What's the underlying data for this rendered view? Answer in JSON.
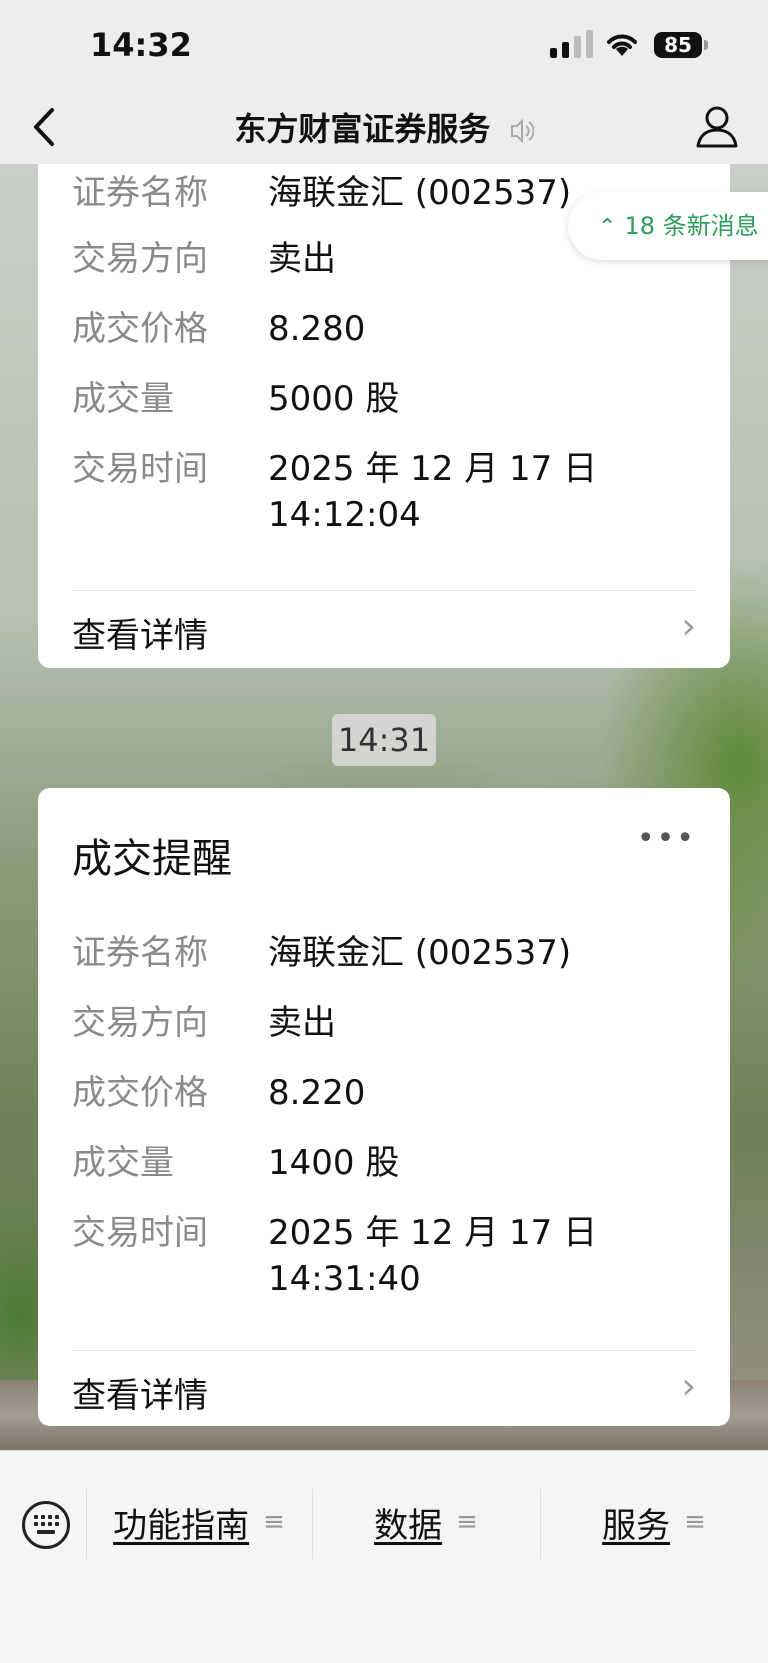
{
  "status": {
    "time": "14:32",
    "battery": "85"
  },
  "nav": {
    "title": "东方财富证券服务"
  },
  "new_messages": {
    "label": "18 条新消息"
  },
  "card1": {
    "rows": [
      {
        "k": "证券名称",
        "v": "海联金汇 (002537)"
      },
      {
        "k": "交易方向",
        "v": "卖出"
      },
      {
        "k": "成交价格",
        "v": "8.280"
      },
      {
        "k": "成交量",
        "v": "5000 股"
      },
      {
        "k": "交易时间",
        "v": "2025 年 12 月 17 日 14:12:04"
      }
    ],
    "detail": "查看详情"
  },
  "timestamp": "14:31",
  "card2": {
    "title": "成交提醒",
    "rows": [
      {
        "k": "证券名称",
        "v": "海联金汇 (002537)"
      },
      {
        "k": "交易方向",
        "v": "卖出"
      },
      {
        "k": "成交价格",
        "v": "8.220"
      },
      {
        "k": "成交量",
        "v": "1400 股"
      },
      {
        "k": "交易时间",
        "v": "2025 年 12 月 17 日 14:31:40"
      }
    ],
    "detail": "查看详情"
  },
  "menu": {
    "items": [
      "功能指南",
      "数据",
      "服务"
    ]
  },
  "icons": {
    "back": "chevron-left-icon",
    "speaker": "speaker-icon",
    "profile": "person-icon",
    "more": "ellipsis-icon",
    "keyboard": "keyboard-icon",
    "menu": "hamburger-icon"
  },
  "colors": {
    "accent": "#2e9e5b",
    "background": "#ededed",
    "card": "#ffffff"
  }
}
